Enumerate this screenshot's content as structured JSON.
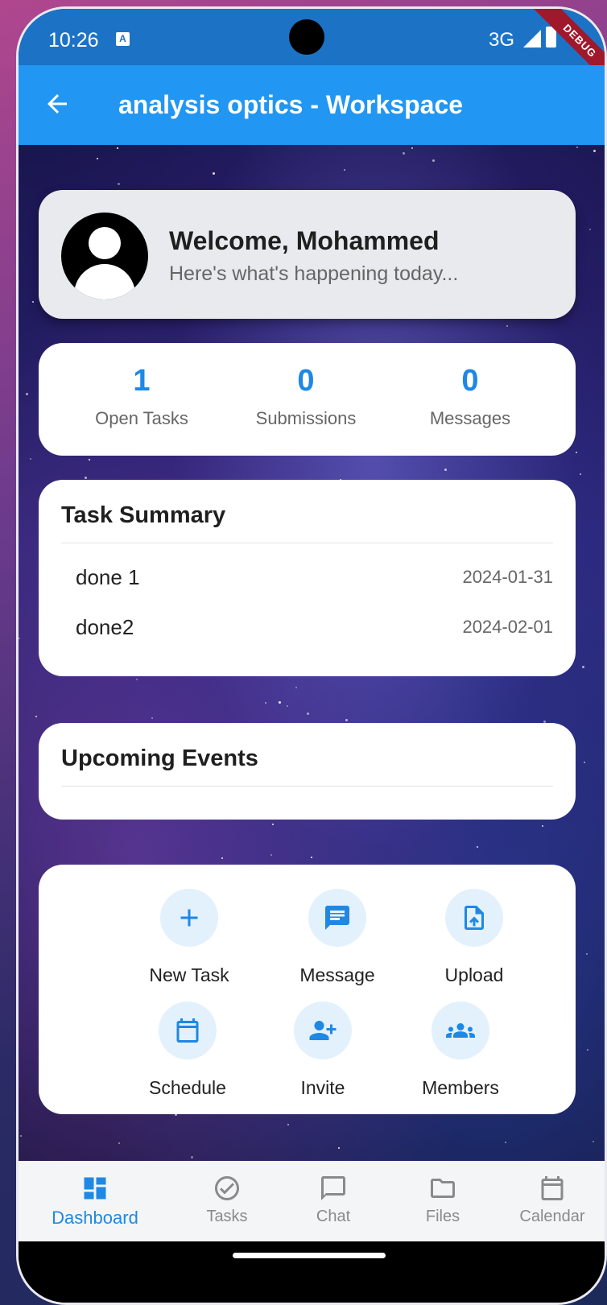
{
  "status_bar": {
    "time": "10:26",
    "network": "3G",
    "notification_icon": "A",
    "ribbon": "DEBUG"
  },
  "app_bar": {
    "title": "analysis optics - Workspace",
    "back_icon": "arrow-back-icon"
  },
  "welcome": {
    "title": "Welcome, Mohammed",
    "subtitle": "Here's what's happening today..."
  },
  "stats": [
    {
      "value": "1",
      "label": "Open Tasks"
    },
    {
      "value": "0",
      "label": "Submissions"
    },
    {
      "value": "0",
      "label": "Messages"
    }
  ],
  "task_summary": {
    "title": "Task Summary",
    "tasks": [
      {
        "name": "done 1",
        "date": "2024-01-31"
      },
      {
        "name": "done2",
        "date": "2024-02-01"
      }
    ]
  },
  "upcoming_events": {
    "title": "Upcoming Events"
  },
  "quick_actions": [
    {
      "label": "New Task",
      "icon": "plus-icon"
    },
    {
      "label": "Message",
      "icon": "message-icon"
    },
    {
      "label": "Upload",
      "icon": "upload-file-icon"
    },
    {
      "label": "Schedule",
      "icon": "calendar-icon"
    },
    {
      "label": "Invite",
      "icon": "person-add-icon"
    },
    {
      "label": "Members",
      "icon": "group-icon"
    }
  ],
  "bottom_nav": [
    {
      "label": "Dashboard",
      "icon": "dashboard-icon",
      "active": true
    },
    {
      "label": "Tasks",
      "icon": "check-circle-icon",
      "active": false
    },
    {
      "label": "Chat",
      "icon": "chat-bubble-icon",
      "active": false
    },
    {
      "label": "Files",
      "icon": "folder-icon",
      "active": false
    },
    {
      "label": "Calendar",
      "icon": "calendar-icon",
      "active": false
    }
  ],
  "colors": {
    "primary": "#2196f3",
    "status_bar": "#1c73c6",
    "accent_text": "#1e88e5",
    "icon_bg": "#e3f1fd"
  }
}
